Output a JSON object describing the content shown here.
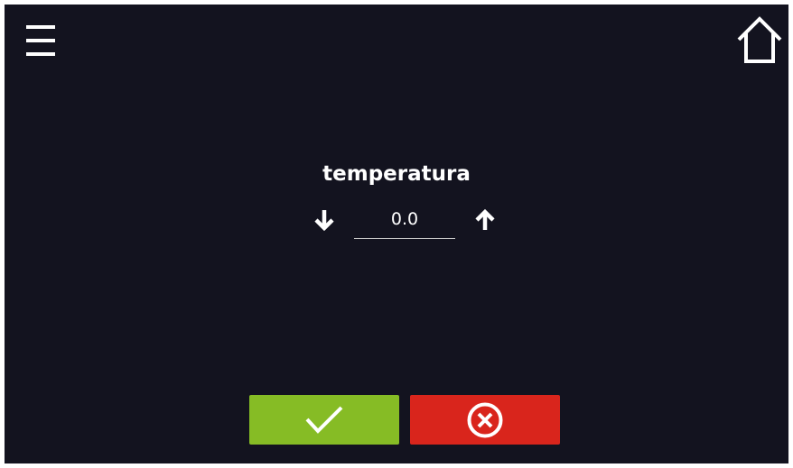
{
  "header": {
    "menu_icon": "hamburger-menu-icon",
    "home_icon": "home-icon"
  },
  "editor": {
    "label": "temperatura",
    "value": "0.0",
    "decrement_icon": "arrow-down-icon",
    "increment_icon": "arrow-up-icon"
  },
  "footer": {
    "confirm_icon": "checkmark-icon",
    "cancel_icon": "cancel-x-circle-icon"
  },
  "colors": {
    "background": "#13131f",
    "confirm": "#86bc25",
    "cancel": "#d9251c",
    "foreground": "#ffffff"
  }
}
